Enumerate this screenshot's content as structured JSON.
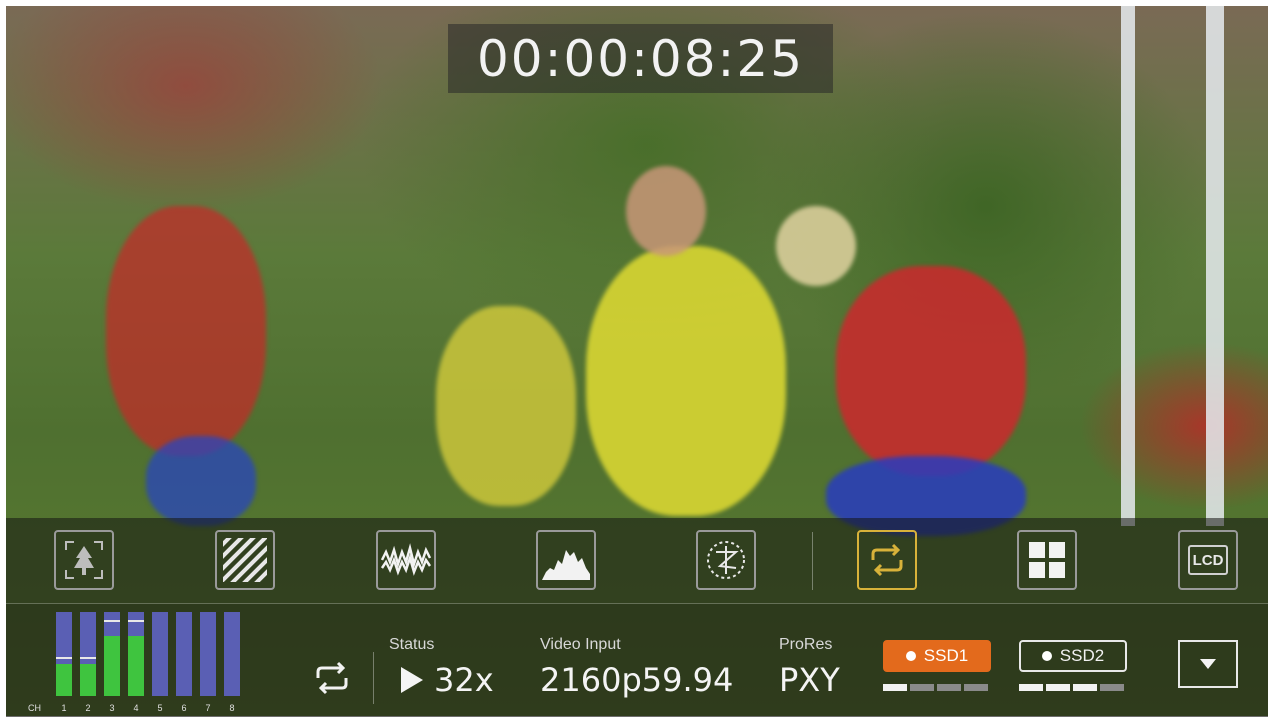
{
  "timecode": "00:00:08:25",
  "toolbar": {
    "tools": [
      {
        "name": "focus-assist-tool",
        "icon": "tree-focus-icon"
      },
      {
        "name": "zebra-tool",
        "icon": "zebra-stripes-icon"
      },
      {
        "name": "waveform-tool",
        "icon": "waveform-icon"
      },
      {
        "name": "histogram-tool",
        "icon": "histogram-icon"
      },
      {
        "name": "vectorscope-tool",
        "icon": "vectorscope-icon"
      },
      {
        "name": "loop-tool",
        "icon": "loop-icon",
        "active": true
      },
      {
        "name": "multiview-tool",
        "icon": "grid-icon"
      },
      {
        "name": "lcd-tool",
        "icon": "lcd-icon",
        "label": "LCD"
      }
    ]
  },
  "audio": {
    "ch_label": "CH",
    "channels": [
      {
        "label": "1",
        "level": 0.38,
        "peak": 0.46
      },
      {
        "label": "2",
        "level": 0.38,
        "peak": 0.46
      },
      {
        "label": "3",
        "level": 0.72,
        "peak": 0.9
      },
      {
        "label": "4",
        "level": 0.72,
        "peak": 0.9
      },
      {
        "label": "5",
        "level": 0,
        "peak": null
      },
      {
        "label": "6",
        "level": 0,
        "peak": null
      },
      {
        "label": "7",
        "level": 0,
        "peak": null
      },
      {
        "label": "8",
        "level": 0,
        "peak": null
      }
    ]
  },
  "status": {
    "label": "Status",
    "speed": "32x"
  },
  "video_input": {
    "label": "Video Input",
    "value": "2160p59.94"
  },
  "codec": {
    "label": "ProRes",
    "value": "PXY"
  },
  "media": {
    "ssd1": {
      "label": "SSD1",
      "fill_fraction": 0.25,
      "active": true
    },
    "ssd2": {
      "label": "SSD2",
      "fill_fraction": 0.75,
      "active": false
    }
  },
  "colors": {
    "accent_orange": "#e36a1c",
    "active_tool_border": "#d8b23a",
    "meter_green": "#3fc43f",
    "meter_blue": "#5a5fb4"
  }
}
